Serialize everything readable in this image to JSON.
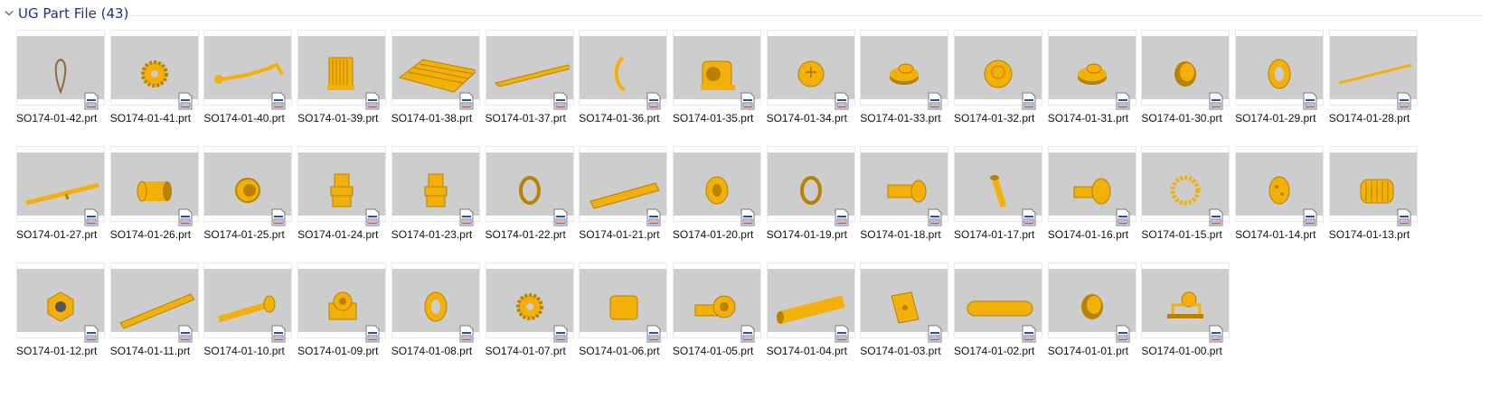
{
  "group": {
    "title": "UG Part File (43)",
    "collapse_icon": "chevron-down-icon"
  },
  "part_color": "#f2b008",
  "files": [
    {
      "name": "SO174-01-42.prt",
      "shape": "loop"
    },
    {
      "name": "SO174-01-41.prt",
      "shape": "gear"
    },
    {
      "name": "SO174-01-40.prt",
      "shape": "lever"
    },
    {
      "name": "SO174-01-39.prt",
      "shape": "frame"
    },
    {
      "name": "SO174-01-38.prt",
      "shape": "plate"
    },
    {
      "name": "SO174-01-37.prt",
      "shape": "rail"
    },
    {
      "name": "SO174-01-36.prt",
      "shape": "clip"
    },
    {
      "name": "SO174-01-35.prt",
      "shape": "housing"
    },
    {
      "name": "SO174-01-34.prt",
      "shape": "knob"
    },
    {
      "name": "SO174-01-33.prt",
      "shape": "flangecap"
    },
    {
      "name": "SO174-01-32.prt",
      "shape": "disc"
    },
    {
      "name": "SO174-01-31.prt",
      "shape": "flangecap"
    },
    {
      "name": "SO174-01-30.prt",
      "shape": "cup"
    },
    {
      "name": "SO174-01-29.prt",
      "shape": "washer"
    },
    {
      "name": "SO174-01-28.prt",
      "shape": "rod"
    },
    {
      "name": "SO174-01-27.prt",
      "shape": "shaft"
    },
    {
      "name": "SO174-01-26.prt",
      "shape": "cylinder"
    },
    {
      "name": "SO174-01-25.prt",
      "shape": "cap"
    },
    {
      "name": "SO174-01-24.prt",
      "shape": "gland"
    },
    {
      "name": "SO174-01-23.prt",
      "shape": "gland"
    },
    {
      "name": "SO174-01-22.prt",
      "shape": "ring"
    },
    {
      "name": "SO174-01-21.prt",
      "shape": "bar"
    },
    {
      "name": "SO174-01-20.prt",
      "shape": "bushing"
    },
    {
      "name": "SO174-01-19.prt",
      "shape": "ring"
    },
    {
      "name": "SO174-01-18.prt",
      "shape": "spline"
    },
    {
      "name": "SO174-01-17.prt",
      "shape": "pin"
    },
    {
      "name": "SO174-01-16.prt",
      "shape": "stepshaft"
    },
    {
      "name": "SO174-01-15.prt",
      "shape": "sprocket"
    },
    {
      "name": "SO174-01-14.prt",
      "shape": "holedisc"
    },
    {
      "name": "SO174-01-13.prt",
      "shape": "motor"
    },
    {
      "name": "SO174-01-12.prt",
      "shape": "nut"
    },
    {
      "name": "SO174-01-11.prt",
      "shape": "blade"
    },
    {
      "name": "SO174-01-10.prt",
      "shape": "bolt"
    },
    {
      "name": "SO174-01-09.prt",
      "shape": "bearing"
    },
    {
      "name": "SO174-01-08.prt",
      "shape": "washer"
    },
    {
      "name": "SO174-01-07.prt",
      "shape": "gear"
    },
    {
      "name": "SO174-01-06.prt",
      "shape": "block"
    },
    {
      "name": "SO174-01-05.prt",
      "shape": "bushing2"
    },
    {
      "name": "SO174-01-04.prt",
      "shape": "tube"
    },
    {
      "name": "SO174-01-03.prt",
      "shape": "tab"
    },
    {
      "name": "SO174-01-02.prt",
      "shape": "slot"
    },
    {
      "name": "SO174-01-01.prt",
      "shape": "cup"
    },
    {
      "name": "SO174-01-00.prt",
      "shape": "assembly"
    }
  ]
}
